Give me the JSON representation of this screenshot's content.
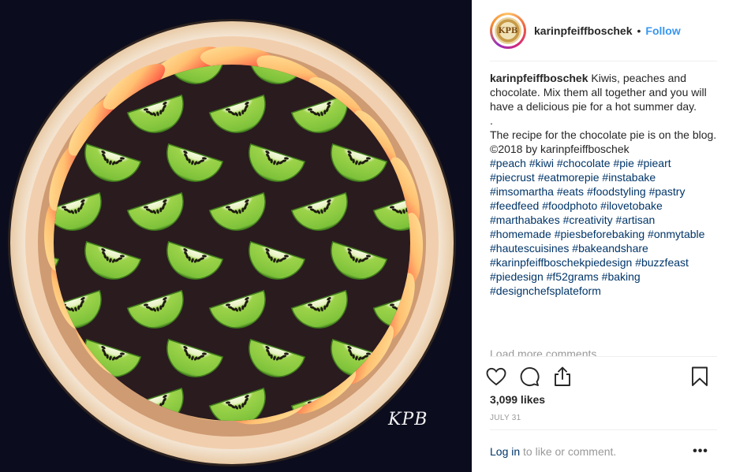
{
  "post": {
    "photo": {
      "alt": "",
      "watermark": "KPB"
    },
    "header": {
      "avatar_text": "KPB",
      "username": "karinpfeiffboschek",
      "separator": "•",
      "follow_label": "Follow"
    },
    "caption": {
      "author": "karinpfeiffboschek",
      "text": "Kiwis, peaches and chocolate. Mix them all together and you will have a delicious pie for a hot summer day.",
      "dot": ".",
      "recipe_line": "The recipe for the chocolate pie is on the blog.",
      "copyright": "©2018 by karinpfeiffboschek",
      "hashtags": [
        "#peach",
        "#kiwi",
        "#chocolate",
        "#pie",
        "#pieart",
        "#piecrust",
        "#eatmorepie",
        "#instabake",
        "#imsomartha",
        "#eats",
        "#foodstyling",
        "#pastry",
        "#feedfeed",
        "#foodphoto",
        "#ilovetobake",
        "#marthabakes",
        "#creativity",
        "#artisan",
        "#homemade",
        "#piesbeforebaking",
        "#onmytable",
        "#hautescuisines",
        "#bakeandshare",
        "#karinpfeiffboschekpiedesign",
        "#buzzfeast",
        "#piedesign",
        "#f52grams",
        "#baking",
        "#designchefsplateform"
      ]
    },
    "load_more_label": "Load more comments",
    "actions": {
      "like_icon": "heart-icon",
      "comment_icon": "comment-icon",
      "share_icon": "share-icon",
      "save_icon": "bookmark-icon"
    },
    "likes_label": "3,099 likes",
    "date_label": "JULY 31",
    "login": {
      "link_label": "Log in",
      "rest_label": " to like or comment."
    },
    "more_label": "•••"
  },
  "colors": {
    "link_blue": "#003569",
    "follow_blue": "#3897f0",
    "muted_gray": "#999999",
    "photo_background": "#0b0c1d"
  }
}
